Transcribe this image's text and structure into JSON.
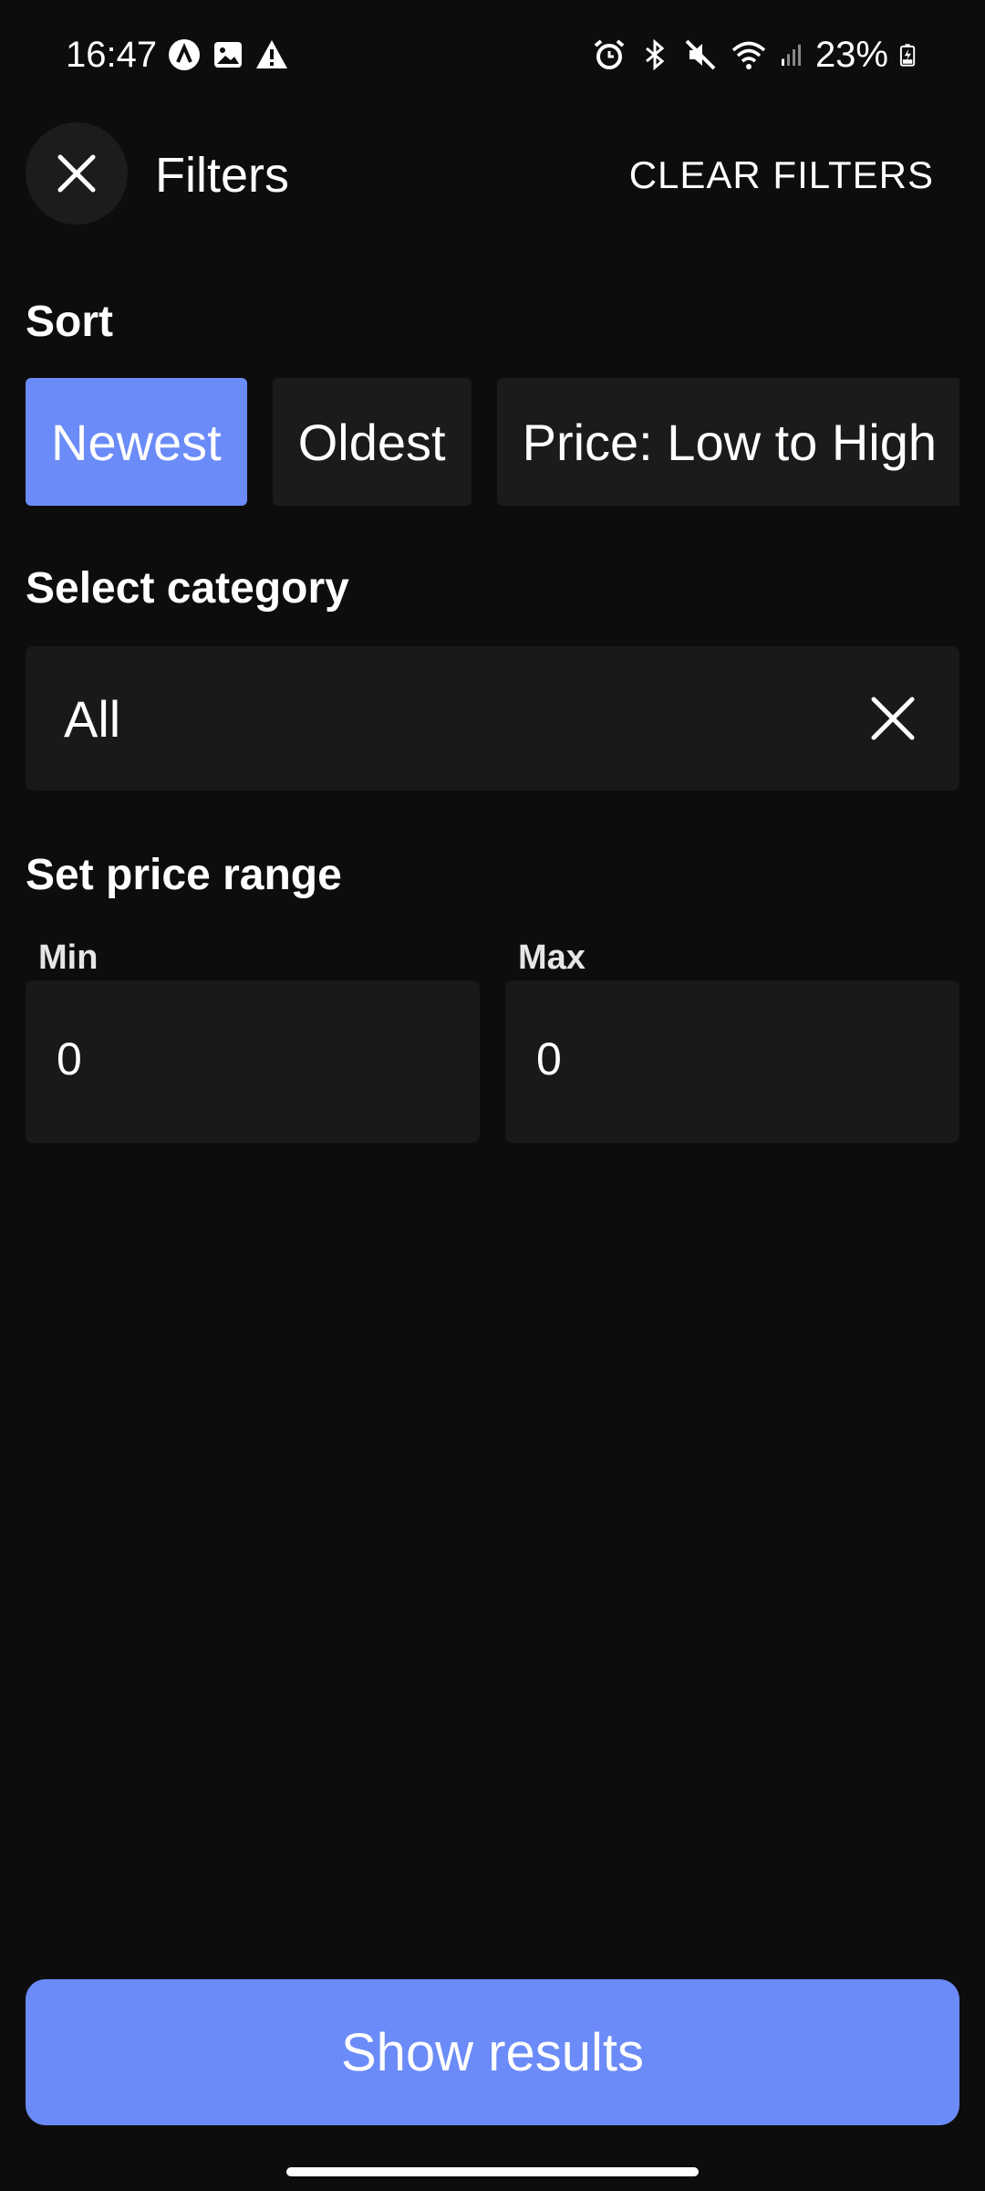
{
  "status_bar": {
    "time": "16:47",
    "battery": "23%",
    "left_icons": [
      "app-notification-icon",
      "gallery-icon",
      "warning-icon"
    ],
    "right_icons": [
      "alarm-icon",
      "bluetooth-icon",
      "mute-icon",
      "wifi-icon",
      "signal-icon",
      "battery-charging-icon"
    ]
  },
  "header": {
    "title": "Filters",
    "clear_label": "CLEAR FILTERS",
    "close_icon": "close-icon"
  },
  "sort": {
    "title": "Sort",
    "options": [
      "Newest",
      "Oldest",
      "Price: Low to High"
    ],
    "selected": "Newest"
  },
  "category": {
    "title": "Select category",
    "value": "All",
    "clear_icon": "close-icon"
  },
  "price_range": {
    "title": "Set price range",
    "min_label": "Min",
    "min_value": "0",
    "max_label": "Max",
    "max_value": "0"
  },
  "footer": {
    "show_results_label": "Show results"
  },
  "colors": {
    "background": "#0d0d0e",
    "accent": "#6b8bf8",
    "surface": "#19191b"
  }
}
